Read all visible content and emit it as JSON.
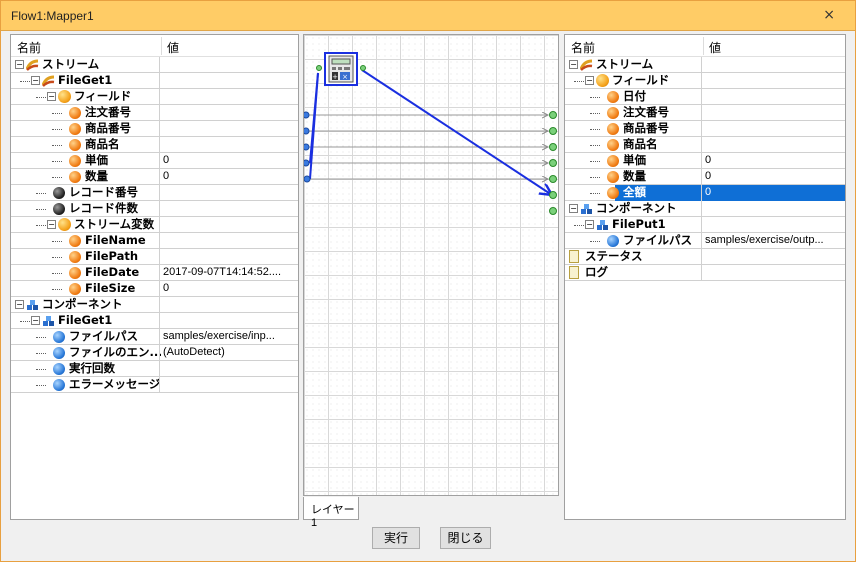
{
  "window": {
    "title": "Flow1:Mapper1",
    "close_glyph": "×"
  },
  "left": {
    "header": {
      "name": "名前",
      "value": "値"
    },
    "rows": [
      {
        "label": "ストリーム",
        "value": "",
        "icon": "stream-icon",
        "depth": 0,
        "toggle": "-"
      },
      {
        "label": "FileGet1",
        "value": "",
        "icon": "stream-icon",
        "depth": 1,
        "toggle": "-"
      },
      {
        "label": "フィールド",
        "value": "",
        "icon": "field-group-icon",
        "depth": 2,
        "toggle": "-"
      },
      {
        "label": "注文番号",
        "value": "",
        "icon": "orange-ball-icon",
        "depth": 3
      },
      {
        "label": "商品番号",
        "value": "",
        "icon": "orange-ball-icon",
        "depth": 3
      },
      {
        "label": "商品名",
        "value": "",
        "icon": "orange-ball-icon",
        "depth": 3
      },
      {
        "label": "単価",
        "value": "0",
        "icon": "orange-ball-icon",
        "depth": 3
      },
      {
        "label": "数量",
        "value": "0",
        "icon": "orange-ball-icon",
        "depth": 3
      },
      {
        "label": "レコード番号",
        "value": "",
        "icon": "black-ball-icon",
        "depth": 2
      },
      {
        "label": "レコード件数",
        "value": "",
        "icon": "black-ball-icon",
        "depth": 2
      },
      {
        "label": "ストリーム変数",
        "value": "",
        "icon": "field-group-icon",
        "depth": 2,
        "toggle": "-"
      },
      {
        "label": "FileName",
        "value": "",
        "icon": "orange-ball-icon",
        "depth": 3
      },
      {
        "label": "FilePath",
        "value": "",
        "icon": "orange-ball-icon",
        "depth": 3
      },
      {
        "label": "FileDate",
        "value": "2017-09-07T14:14:52....",
        "icon": "orange-ball-icon",
        "depth": 3
      },
      {
        "label": "FileSize",
        "value": "0",
        "icon": "orange-ball-icon",
        "depth": 3
      },
      {
        "label": "コンポーネント",
        "value": "",
        "icon": "component-icon",
        "depth": 0,
        "toggle": "-"
      },
      {
        "label": "FileGet1",
        "value": "",
        "icon": "component-icon",
        "depth": 1,
        "toggle": "-"
      },
      {
        "label": "ファイルパス",
        "value": "samples/exercise/inp...",
        "icon": "blue-ball-icon",
        "depth": 2
      },
      {
        "label": "ファイルのエン...",
        "value": "(AutoDetect)",
        "icon": "blue-ball-icon",
        "depth": 2
      },
      {
        "label": "実行回数",
        "value": "",
        "icon": "blue-ball-icon",
        "depth": 2
      },
      {
        "label": "エラーメッセージ",
        "value": "",
        "icon": "blue-ball-icon",
        "depth": 2
      }
    ]
  },
  "right": {
    "header": {
      "name": "名前",
      "value": "値"
    },
    "rows": [
      {
        "label": "ストリーム",
        "value": "",
        "icon": "stream-icon",
        "depth": 0,
        "toggle": "-"
      },
      {
        "label": "フィールド",
        "value": "",
        "icon": "field-group-icon",
        "depth": 1,
        "toggle": "-"
      },
      {
        "label": "日付",
        "value": "",
        "icon": "orange-ball-icon",
        "depth": 2
      },
      {
        "label": "注文番号",
        "value": "",
        "icon": "orange-ball-icon",
        "depth": 2
      },
      {
        "label": "商品番号",
        "value": "",
        "icon": "orange-ball-icon",
        "depth": 2
      },
      {
        "label": "商品名",
        "value": "",
        "icon": "orange-ball-icon",
        "depth": 2
      },
      {
        "label": "単価",
        "value": "0",
        "icon": "orange-ball-icon",
        "depth": 2
      },
      {
        "label": "数量",
        "value": "0",
        "icon": "orange-ball-icon",
        "depth": 2
      },
      {
        "label": "全額",
        "value": "0",
        "icon": "orange-ball-icon",
        "depth": 2,
        "selected": true
      },
      {
        "label": "コンポーネント",
        "value": "",
        "icon": "component-icon",
        "depth": 0,
        "toggle": "-"
      },
      {
        "label": "FilePut1",
        "value": "",
        "icon": "component-icon",
        "depth": 1,
        "toggle": "-"
      },
      {
        "label": "ファイルパス",
        "value": "samples/exercise/outp...",
        "icon": "blue-ball-icon",
        "depth": 2
      },
      {
        "label": "ステータス",
        "value": "",
        "icon": "document-icon",
        "depth": 0
      },
      {
        "label": "ログ",
        "value": "",
        "icon": "document-icon",
        "depth": 0
      }
    ]
  },
  "canvas": {
    "layer_tab": "レイヤー1",
    "node_icon": "calculator-icon"
  },
  "buttons": {
    "run": "実行",
    "close": "閉じる"
  },
  "colors": {
    "titlebar": "#ffcc66",
    "selection": "#0f6fd6",
    "mapping_line": "#1a2fe0"
  }
}
